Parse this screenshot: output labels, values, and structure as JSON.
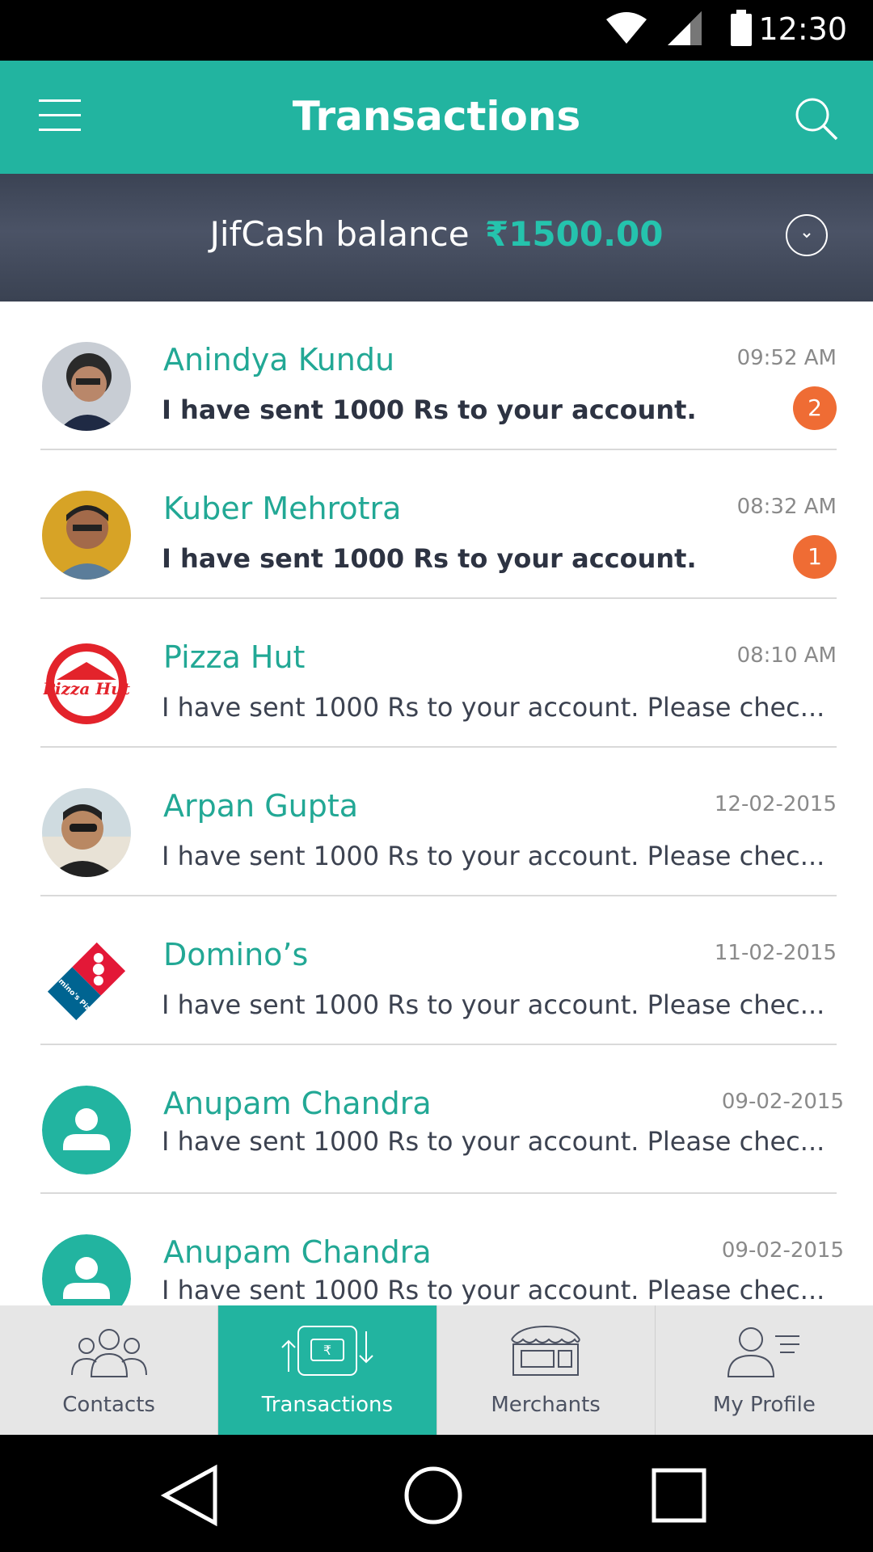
{
  "status_bar": {
    "time": "12:30",
    "icons": [
      "wifi-icon",
      "signal-icon",
      "battery-icon"
    ]
  },
  "app_bar": {
    "title": "Transactions",
    "menu_icon": "menu-icon",
    "search_icon": "search-icon",
    "color": "#22b4a0"
  },
  "balance": {
    "label": "JifCash balance",
    "currency": "₹",
    "amount": "1500.00",
    "toggle_icon": "chevron-down-icon"
  },
  "transactions": [
    {
      "name": "Anindya Kundu",
      "message": "I have sent 1000 Rs to your account.",
      "time": "09:52 AM",
      "unread": "2",
      "avatar": "photo-person"
    },
    {
      "name": "Kuber Mehrotra",
      "message": "I have sent 1000 Rs to your account.",
      "time": "08:32 AM",
      "unread": "1",
      "avatar": "photo-person"
    },
    {
      "name": "Pizza Hut",
      "message": "I have sent 1000 Rs to your account. Please chec...",
      "time": "08:10 AM",
      "unread": null,
      "avatar": "pizza-hut-logo"
    },
    {
      "name": "Arpan Gupta",
      "message": "I have sent 1000 Rs to your account. Please chec...",
      "time": "12-02-2015",
      "unread": null,
      "avatar": "photo-person"
    },
    {
      "name": "Domino’s",
      "message": "I have sent 1000 Rs to your account. Please chec...",
      "time": "11-02-2015",
      "unread": null,
      "avatar": "dominos-logo"
    },
    {
      "name": "Anupam Chandra",
      "message": "I have sent 1000 Rs to your account. Please chec...",
      "time": "09-02-2015",
      "unread": null,
      "avatar": "default-user-icon"
    },
    {
      "name": "Anupam Chandra",
      "message": "I have sent 1000 Rs to your account. Please chec...",
      "time": "09-02-2015",
      "unread": null,
      "avatar": "default-user-icon"
    }
  ],
  "logo_text": {
    "pizza_hut": "Pizza Hut",
    "dominos": "Domino's Pizza"
  },
  "bottom_nav": [
    {
      "label": "Contacts",
      "icon": "contacts-icon",
      "active": false
    },
    {
      "label": "Transactions",
      "icon": "transactions-icon",
      "active": true
    },
    {
      "label": "Merchants",
      "icon": "merchants-icon",
      "active": false
    },
    {
      "label": "My Profile",
      "icon": "profile-icon",
      "active": false
    }
  ],
  "transaction_icon_symbol": "₹",
  "colors": {
    "accent": "#22b4a0",
    "badge": "#ef6c34",
    "name_text": "#22a895"
  }
}
